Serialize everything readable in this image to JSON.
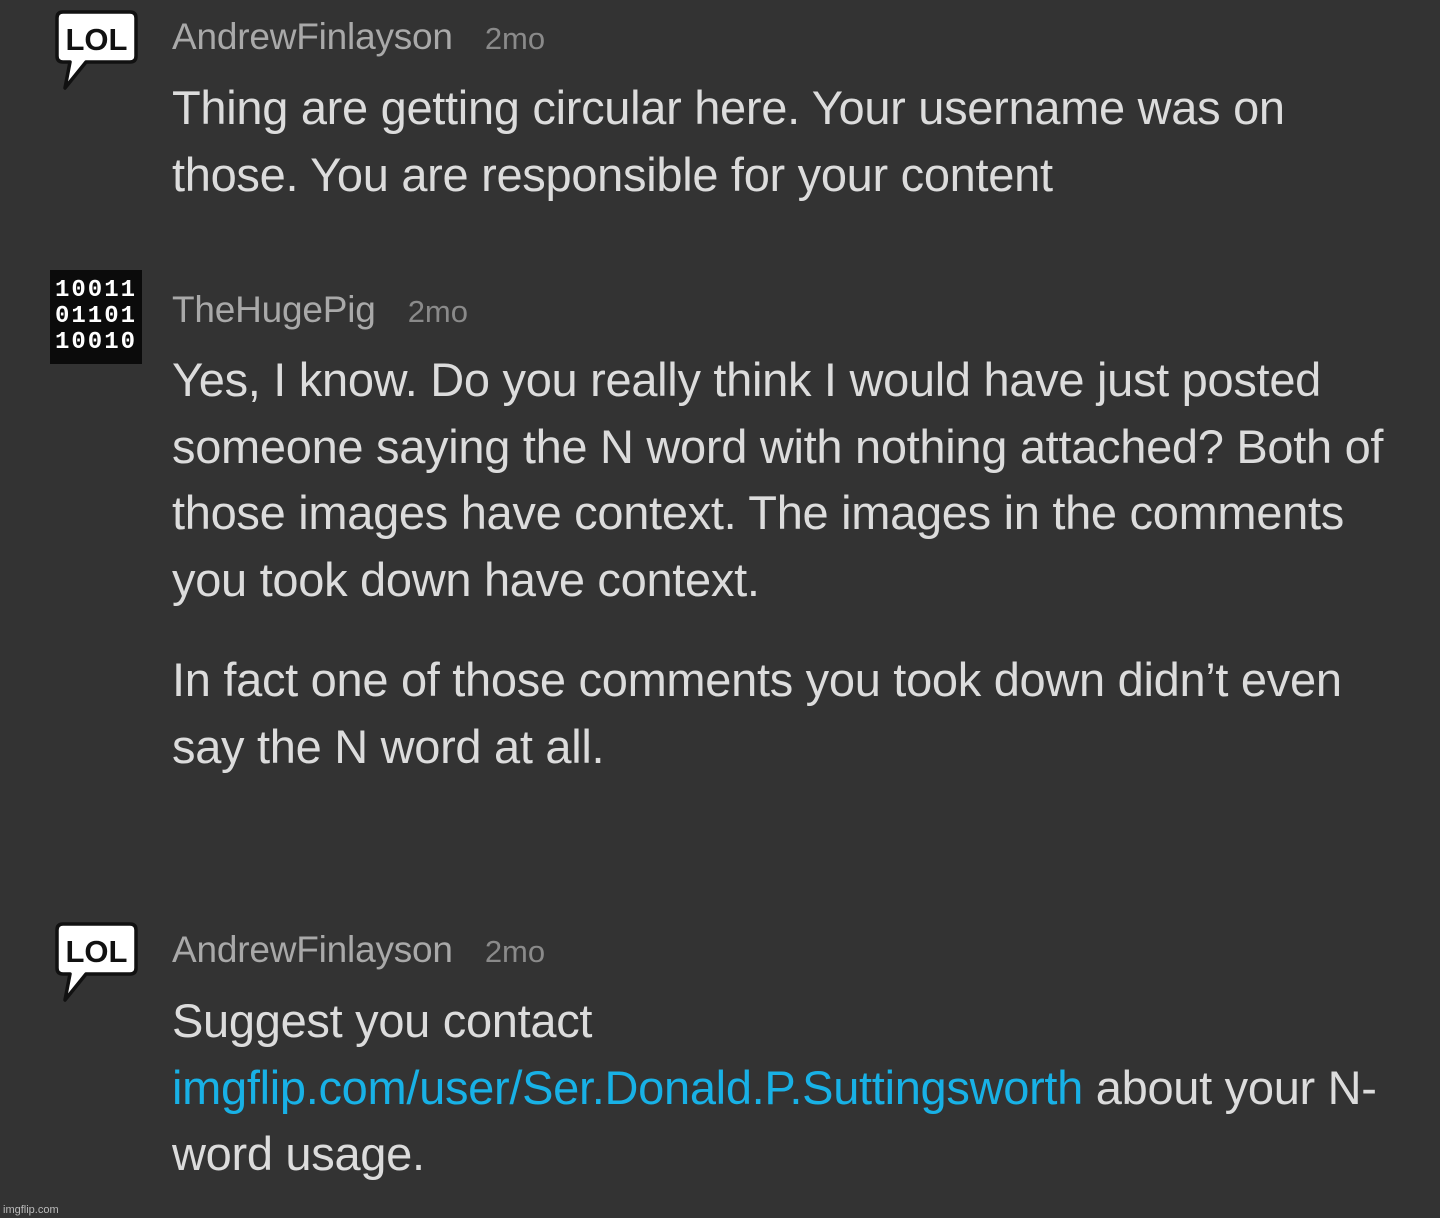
{
  "comments": [
    {
      "username": "AndrewFinlayson",
      "time": "2mo",
      "avatar_icon": "lol-speech-bubble-icon",
      "paragraphs": [
        "Thing are getting circular here. Your username was on those. You are responsible for your content"
      ]
    },
    {
      "username": "TheHugePig",
      "time": "2mo",
      "avatar_icon": "binary-code-icon",
      "paragraphs": [
        "Yes, I know. Do you really think I would have just posted someone saying the N word with nothing attached? Both of those images have context. The images in the comments you took down have context.",
        "In fact one of those comments you took down didn’t even say the N word at all."
      ]
    },
    {
      "username": "AndrewFinlayson",
      "time": "2mo",
      "avatar_icon": "lol-speech-bubble-icon",
      "text_before": "Suggest you contact",
      "link": "imgflip.com/user/Ser.Donald.P.Suttingsworth",
      "text_after": "about your N-word usage."
    }
  ],
  "lol_avatar_text": "LOL",
  "binary_avatar_rows": [
    "10011",
    "01101",
    "10010"
  ],
  "watermark": "imgflip.com",
  "colors": {
    "background": "#333333",
    "username": "#a9a9a9",
    "timestamp": "#8a8a8a",
    "body": "#dcdcdc",
    "link": "#18b1e6"
  }
}
